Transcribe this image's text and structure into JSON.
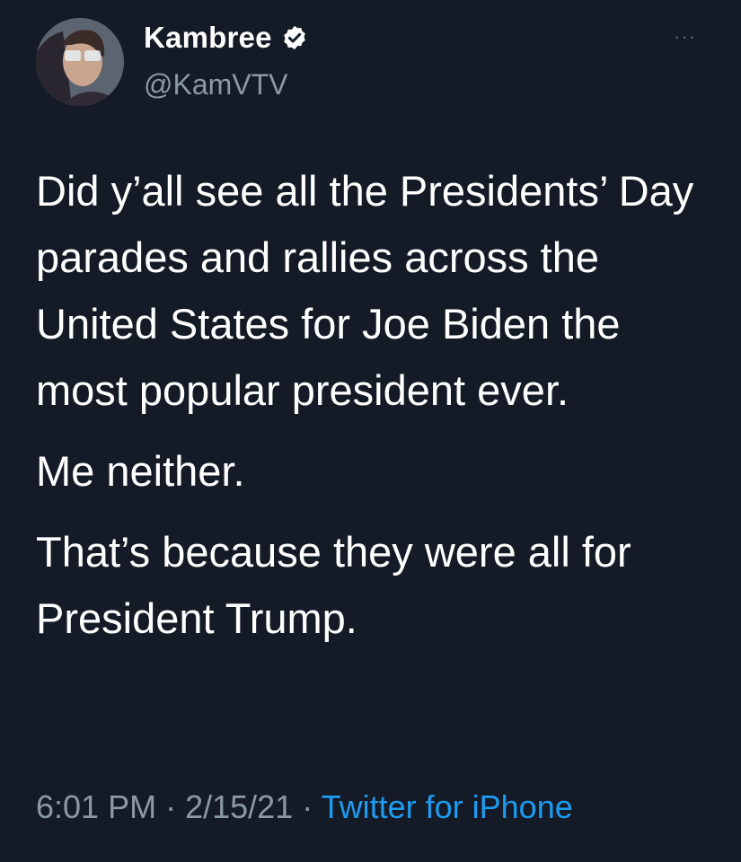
{
  "tweet": {
    "author": {
      "display_name": "Kambree",
      "handle": "@KamVTV",
      "verified": true,
      "avatar_icon": "avatar-photo"
    },
    "more_label": "···",
    "paragraphs": [
      "Did y’all see all the Presidents’ Day parades and rallies across the United States for Joe Biden the most popular president ever.",
      "Me neither.",
      "That’s because they were all for President Trump."
    ],
    "meta": {
      "time": "6:01 PM",
      "separator": "·",
      "date": "2/15/21",
      "source": "Twitter for iPhone"
    }
  },
  "colors": {
    "background": "#141b26",
    "text": "#ffffff",
    "secondary": "#8b98a5",
    "accent": "#1d9bf0"
  }
}
